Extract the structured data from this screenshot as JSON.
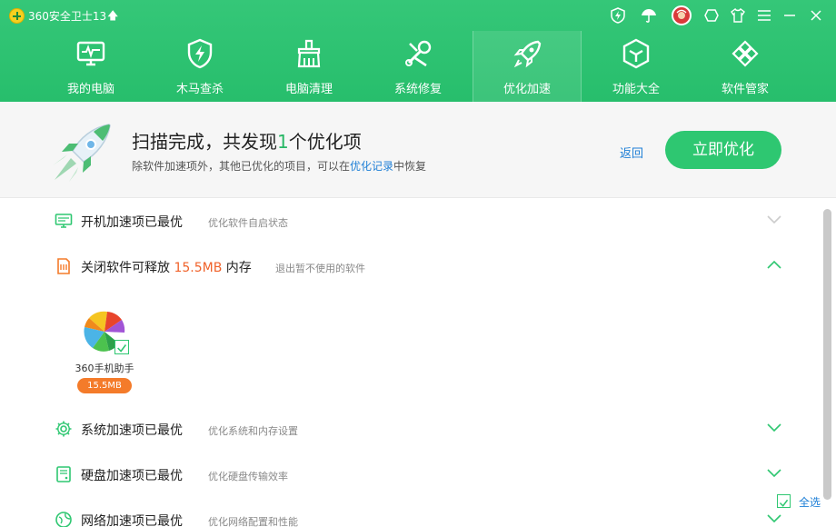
{
  "titlebar": {
    "app_title": "360安全卫士13",
    "icons": [
      "shield-bolt-icon",
      "umbrella-icon",
      "avatar",
      "gift-icon",
      "shirt-icon",
      "menu-icon",
      "minimize-icon",
      "close-icon"
    ]
  },
  "nav": {
    "items": [
      {
        "label": "我的电脑",
        "icon": "monitor-icon"
      },
      {
        "label": "木马查杀",
        "icon": "shield-bolt-icon"
      },
      {
        "label": "电脑清理",
        "icon": "broom-icon"
      },
      {
        "label": "系统修复",
        "icon": "wrench-icon"
      },
      {
        "label": "优化加速",
        "icon": "rocket-icon",
        "active": true
      },
      {
        "label": "功能大全",
        "icon": "cube-icon"
      },
      {
        "label": "软件管家",
        "icon": "apps-icon"
      }
    ]
  },
  "banner": {
    "title_prefix": "扫描完成，共发现",
    "title_count": "1",
    "title_suffix": "个优化项",
    "sub_prefix": "除软件加速项外，其他已优化的项目，可以在",
    "sub_link": "优化记录",
    "sub_suffix": "中恢复",
    "back_label": "返回",
    "optimize_label": "立即优化"
  },
  "sections": [
    {
      "title": "开机加速项已最优",
      "desc": "优化软件自启状态",
      "icon": "monitor-icon",
      "expanded": false
    },
    {
      "title_prefix": "关闭软件可释放 ",
      "title_value": "15.5MB",
      "title_suffix": " 内存",
      "desc": "退出暂不使用的软件",
      "icon": "memory-icon",
      "expanded": true
    },
    {
      "title": "系统加速项已最优",
      "desc": "优化系统和内存设置",
      "icon": "gear-icon",
      "expanded": false
    },
    {
      "title": "硬盘加速项已最优",
      "desc": "优化硬盘传输效率",
      "icon": "harddisk-icon",
      "expanded": false
    },
    {
      "title": "网络加速项已最优",
      "desc": "优化网络配置和性能",
      "icon": "globe-icon",
      "expanded": false
    }
  ],
  "apps": [
    {
      "name": "360手机助手",
      "size": "15.5MB",
      "checked": true
    }
  ],
  "footer": {
    "select_all_label": "全选"
  },
  "colors": {
    "brand_green": "#2ec771",
    "link_blue": "#1e7fd6",
    "highlight_orange": "#f0622a",
    "badge_orange": "#f47b2a"
  }
}
